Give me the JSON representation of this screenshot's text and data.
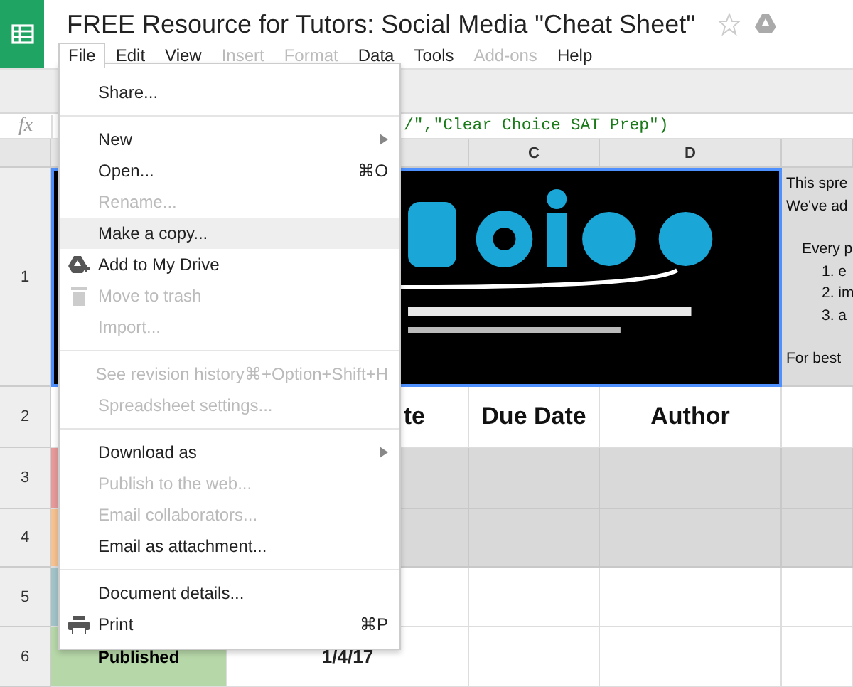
{
  "document": {
    "title": "FREE Resource for Tutors: Social Media \"Cheat Sheet\"",
    "starred": false
  },
  "menubar": [
    {
      "label": "File",
      "selected": true,
      "disabled": false
    },
    {
      "label": "Edit",
      "selected": false,
      "disabled": false
    },
    {
      "label": "View",
      "selected": false,
      "disabled": false
    },
    {
      "label": "Insert",
      "selected": false,
      "disabled": true
    },
    {
      "label": "Format",
      "selected": false,
      "disabled": true
    },
    {
      "label": "Data",
      "selected": false,
      "disabled": false
    },
    {
      "label": "Tools",
      "selected": false,
      "disabled": false
    },
    {
      "label": "Add-ons",
      "selected": false,
      "disabled": true
    },
    {
      "label": "Help",
      "selected": false,
      "disabled": false
    }
  ],
  "formula_bar": {
    "label": "fx",
    "value": "/\",\"Clear Choice SAT Prep\")"
  },
  "file_menu": [
    {
      "kind": "item",
      "label": "Share...",
      "disabled": false,
      "selected": false
    },
    {
      "kind": "separator"
    },
    {
      "kind": "item",
      "label": "New",
      "disabled": false,
      "selected": false,
      "submenu": true
    },
    {
      "kind": "item",
      "label": "Open...",
      "shortcut": "⌘O",
      "disabled": false,
      "selected": false
    },
    {
      "kind": "item",
      "label": "Rename...",
      "disabled": true,
      "selected": false
    },
    {
      "kind": "item",
      "label": "Make a copy...",
      "disabled": false,
      "selected": true
    },
    {
      "kind": "drive",
      "label": "Add to My Drive",
      "disabled": false,
      "selected": false
    },
    {
      "kind": "trash",
      "label": "Move to trash",
      "disabled": true,
      "selected": false
    },
    {
      "kind": "item",
      "label": "Import...",
      "disabled": true,
      "selected": false
    },
    {
      "kind": "separator"
    },
    {
      "kind": "item",
      "label": "See revision history",
      "shortcut": "⌘+Option+Shift+H",
      "disabled": true,
      "selected": false
    },
    {
      "kind": "item",
      "label": "Spreadsheet settings...",
      "disabled": true,
      "selected": false
    },
    {
      "kind": "separator"
    },
    {
      "kind": "item",
      "label": "Download as",
      "disabled": false,
      "selected": false,
      "submenu": true
    },
    {
      "kind": "item",
      "label": "Publish to the web...",
      "disabled": true,
      "selected": false
    },
    {
      "kind": "item",
      "label": "Email collaborators...",
      "disabled": true,
      "selected": false
    },
    {
      "kind": "item",
      "label": "Email as attachment...",
      "disabled": false,
      "selected": false
    },
    {
      "kind": "separator"
    },
    {
      "kind": "item",
      "label": "Document details...",
      "disabled": false,
      "selected": false
    },
    {
      "kind": "print",
      "label": "Print",
      "shortcut": "⌘P",
      "disabled": false,
      "selected": false
    }
  ],
  "sheet": {
    "column_headers": [
      {
        "label": "C"
      },
      {
        "label": "D"
      }
    ],
    "banner_row": {
      "number": "1",
      "notes": [
        {
          "kind": "line",
          "text": "This spre"
        },
        {
          "kind": "line",
          "text": "We've ad"
        },
        {
          "kind": "indented",
          "text": "Every p"
        },
        {
          "kind": "numbered",
          "text": "1. e"
        },
        {
          "kind": "numbered",
          "text": "2. im"
        },
        {
          "kind": "numbered",
          "text": "3. a"
        },
        {
          "kind": "line",
          "text": "For best"
        }
      ]
    },
    "header_row": {
      "number": "2",
      "cells": [
        "te",
        "Due Date",
        "Author"
      ]
    },
    "rows": [
      {
        "number": "3",
        "color": "#e69a9a",
        "shaded": true
      },
      {
        "number": "4",
        "color": "#f6c28f",
        "shaded": true
      },
      {
        "number": "5",
        "color": "#a2c4c9",
        "shaded": false
      },
      {
        "number": "6",
        "color": "#b6d7a8",
        "shaded": false,
        "status": "Published",
        "date": "1/4/17"
      }
    ]
  }
}
